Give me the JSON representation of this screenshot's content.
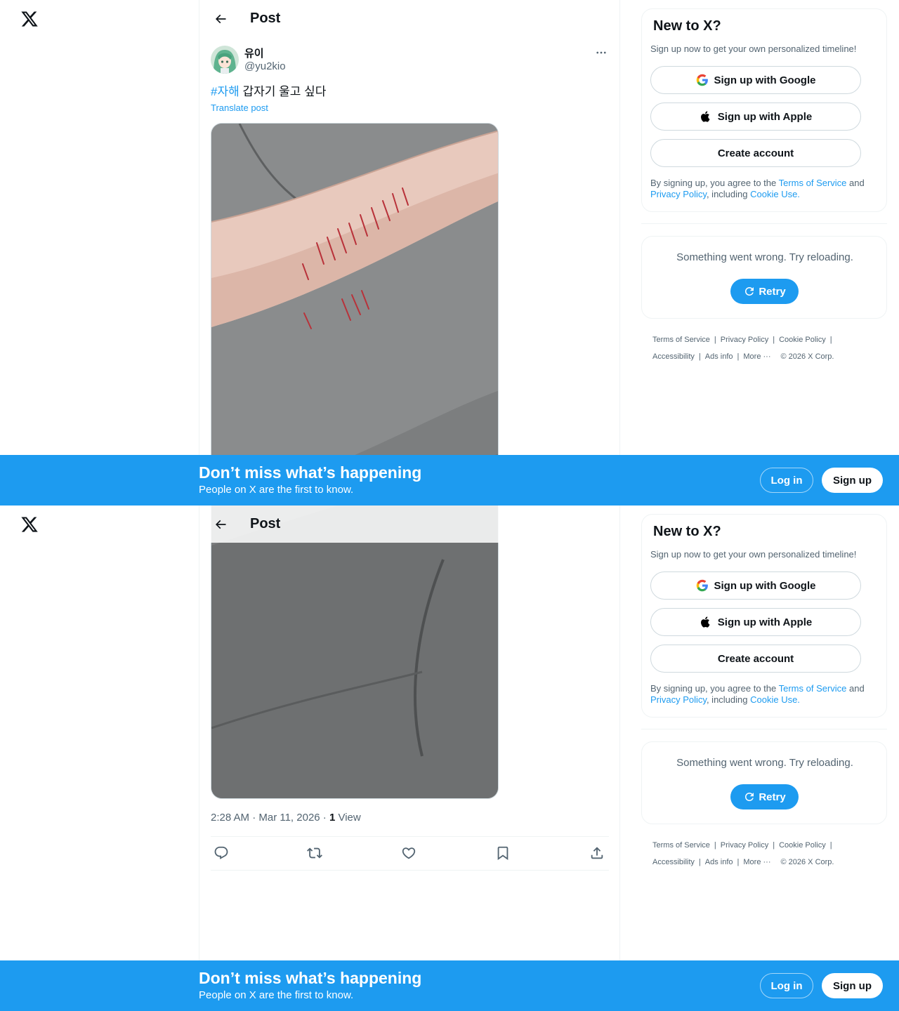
{
  "header": {
    "title": "Post"
  },
  "post": {
    "author_name": "유이",
    "handle": "@yu2kio",
    "hashtag": "#자해",
    "text": " 갑자기 울고 싶다",
    "translate_label": "Translate post",
    "timestamp": "2:28 AM · Mar 11, 2026 · ",
    "view_count": "1",
    "view_label": " View"
  },
  "sidebar": {
    "signup_title": "New to X?",
    "signup_subtitle": "Sign up now to get your own personalized timeline!",
    "google_label": "Sign up with Google",
    "apple_label": "Sign up with Apple",
    "create_label": "Create account",
    "terms_prefix": "By signing up, you agree to the ",
    "terms_link": "Terms of Service",
    "terms_and": " and ",
    "privacy_link": "Privacy Policy",
    "terms_mid": ", including ",
    "cookie_link": "Cookie Use.",
    "error_text": "Something went wrong. Try reloading.",
    "retry_label": "Retry"
  },
  "footer": {
    "terms": "Terms of Service",
    "privacy": "Privacy Policy",
    "cookie": "Cookie Policy",
    "accessibility": "Accessibility",
    "ads": "Ads info",
    "more": "More ···",
    "copyright": "© 2026 X Corp.",
    "sep": "|"
  },
  "banner": {
    "title": "Don’t miss what’s happening",
    "subtitle": "People on X are the first to know.",
    "login_label": "Log in",
    "signup_label": "Sign up"
  },
  "colors": {
    "accent": "#1d9bf0",
    "text": "#0f1419",
    "secondary": "#536471",
    "border": "#eff3f4"
  }
}
